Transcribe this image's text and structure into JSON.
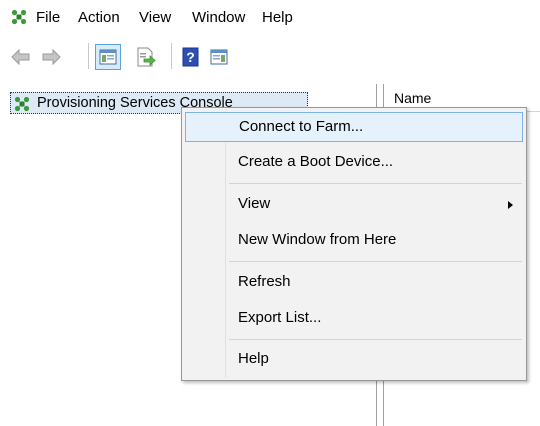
{
  "menubar": {
    "items": [
      {
        "label": "File"
      },
      {
        "label": "Action"
      },
      {
        "label": "View"
      },
      {
        "label": "Window"
      },
      {
        "label": "Help"
      }
    ]
  },
  "toolbar": {
    "buttons": [
      {
        "icon": "back-arrow-icon"
      },
      {
        "icon": "forward-arrow-icon"
      },
      {
        "icon": "show-hide-console-tree-icon",
        "active": true
      },
      {
        "icon": "export-list-icon"
      },
      {
        "icon": "help-icon"
      },
      {
        "icon": "show-hide-action-pane-icon"
      }
    ]
  },
  "tree": {
    "root_label": "Provisioning Services Console",
    "root_icon": "citrix-console-icon"
  },
  "list": {
    "columns": [
      {
        "label": "Name"
      }
    ]
  },
  "context_menu": {
    "items": [
      {
        "label": "Connect to Farm...",
        "highlighted": true
      },
      {
        "label": "Create a Boot Device..."
      },
      {
        "label": "View",
        "submenu": true
      },
      {
        "label": "New Window from Here"
      },
      {
        "label": "Refresh"
      },
      {
        "label": "Export List..."
      },
      {
        "label": "Help"
      }
    ]
  },
  "colors": {
    "accent": "#3c9a3c",
    "highlight_border": "#7bb3e6",
    "highlight_bg": "#e5f1fb",
    "menu_bg": "#f2f2f2"
  }
}
